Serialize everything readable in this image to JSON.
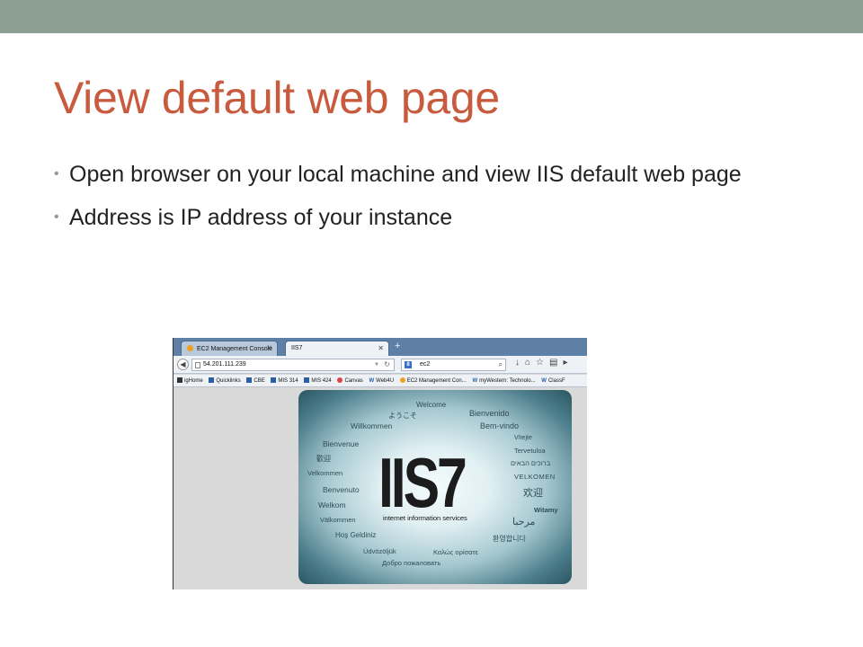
{
  "slide": {
    "title": "View default web page",
    "bullets": [
      "Open browser on your local machine and view IIS default web page",
      "Address is IP address of your instance"
    ],
    "accent_color": "#8d9f93",
    "title_color": "#c85a3e"
  },
  "browser": {
    "tabs": [
      {
        "label": "EC2 Management Console",
        "icon": "aws-icon"
      },
      {
        "label": "IIS7",
        "icon": "page-icon"
      }
    ],
    "new_tab": "+",
    "address": "54.201.111.239",
    "search_engine": "8",
    "search_value": "ec2",
    "bookmarks": [
      "igHome",
      "Quicklinks",
      "CBE",
      "MIS 314",
      "MIS 424",
      "Canvas",
      "Web4U",
      "EC2 Management Con...",
      "myWestern: Technolo...",
      "ClassF"
    ]
  },
  "iis_page": {
    "logo": "IIS7",
    "subtitle": "internet information services",
    "words": {
      "welcome": "Welcome",
      "youkoso": "ようこそ",
      "bienvenido": "Bienvenido",
      "willkommen": "Willkommen",
      "bemvindo": "Bem-vindo",
      "vitejte": "Vítejte",
      "bienvenue": "Bienvenue",
      "tervetuloa": "Tervetuloa",
      "huanying_trad": "歡迎",
      "hebrew": "ברוכים הבאים",
      "velkommen_da": "Velkommen",
      "velkomen_no": "VELKOMEN",
      "benvenuto": "Benvenuto",
      "huanying_simpl": "欢迎",
      "welkom": "Welkom",
      "witamy": "Witamy",
      "valkommen": "Välkommen",
      "marhaba": "مرحبا",
      "hos_geldiniz": "Hoş Geldiniz",
      "korean": "환영합니다",
      "udvozoljuk": "Üdvözöljük",
      "kalos": "Καλώς ορίσατε",
      "russian": "Добро пожаловать"
    }
  }
}
